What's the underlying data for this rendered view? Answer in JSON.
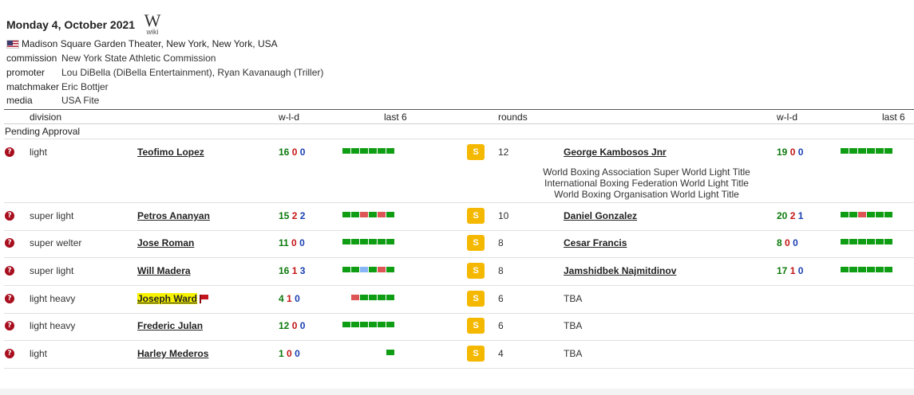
{
  "event": {
    "date": "Monday 4, October 2021",
    "wiki_label": "wiki",
    "wiki_glyph": "W",
    "venue": "Madison Square Garden Theater, New York, New York, USA",
    "meta": [
      {
        "key": "commission",
        "value": "New York State Athletic Commission"
      },
      {
        "key": "promoter",
        "value": "Lou DiBella (DiBella Entertainment), Ryan Kavanaugh (Triller)"
      },
      {
        "key": "matchmaker",
        "value": "Eric Bottjer"
      },
      {
        "key": "media",
        "value": "USA Fite"
      }
    ]
  },
  "table": {
    "headers": {
      "division": "division",
      "wld_left": "w-l-d",
      "last6_left": "last 6",
      "rounds": "rounds",
      "wld_right": "w-l-d",
      "last6_right": "last 6"
    },
    "section_label": "Pending Approval",
    "status_icon": "question-circle-icon",
    "badge_label": "S",
    "colors": {
      "win": "#0f9d14",
      "loss": "#dd5555",
      "draw": "#88b5f5",
      "badge": "#f5b800",
      "highlight": "#f7f300"
    },
    "bouts": [
      {
        "division": "light",
        "boxer1": "Teofimo Lopez",
        "wld1": {
          "w": "16",
          "l": "0",
          "d": "0"
        },
        "last6_1": [
          "W",
          "W",
          "W",
          "W",
          "W",
          "W"
        ],
        "rounds": "12",
        "boxer2": "George Kambosos Jnr",
        "wld2": {
          "w": "19",
          "l": "0",
          "d": "0"
        },
        "last6_2": [
          "W",
          "W",
          "W",
          "W",
          "W",
          "W"
        ],
        "titles": [
          "World Boxing Association Super World Light Title",
          "International Boxing Federation World Light Title",
          "World Boxing Organisation World Light Title"
        ]
      },
      {
        "division": "super light",
        "boxer1": "Petros Ananyan",
        "wld1": {
          "w": "15",
          "l": "2",
          "d": "2"
        },
        "last6_1": [
          "W",
          "W",
          "L",
          "W",
          "L",
          "W"
        ],
        "rounds": "10",
        "boxer2": "Daniel Gonzalez",
        "wld2": {
          "w": "20",
          "l": "2",
          "d": "1"
        },
        "last6_2": [
          "W",
          "W",
          "L",
          "W",
          "W",
          "W"
        ]
      },
      {
        "division": "super welter",
        "boxer1": "Jose Roman",
        "wld1": {
          "w": "11",
          "l": "0",
          "d": "0"
        },
        "last6_1": [
          "W",
          "W",
          "W",
          "W",
          "W",
          "W"
        ],
        "rounds": "8",
        "boxer2": "Cesar Francis",
        "wld2": {
          "w": "8",
          "l": "0",
          "d": "0"
        },
        "last6_2": [
          "W",
          "W",
          "W",
          "W",
          "W",
          "W"
        ]
      },
      {
        "division": "super light",
        "boxer1": "Will Madera",
        "wld1": {
          "w": "16",
          "l": "1",
          "d": "3"
        },
        "last6_1": [
          "W",
          "W",
          "D",
          "W",
          "L",
          "W"
        ],
        "rounds": "8",
        "boxer2": "Jamshidbek Najmitdinov",
        "wld2": {
          "w": "17",
          "l": "1",
          "d": "0"
        },
        "last6_2": [
          "W",
          "W",
          "W",
          "W",
          "W",
          "W"
        ]
      },
      {
        "division": "light heavy",
        "boxer1": "Joseph Ward",
        "boxer1_flagged": true,
        "wld1": {
          "w": "4",
          "l": "1",
          "d": "0"
        },
        "last6_1": [
          "L",
          "W",
          "W",
          "W",
          "W"
        ],
        "rounds": "6",
        "boxer2_tba": "TBA"
      },
      {
        "division": "light heavy",
        "boxer1": "Frederic Julan",
        "wld1": {
          "w": "12",
          "l": "0",
          "d": "0"
        },
        "last6_1": [
          "W",
          "W",
          "W",
          "W",
          "W",
          "W"
        ],
        "rounds": "6",
        "boxer2_tba": "TBA"
      },
      {
        "division": "light",
        "boxer1": "Harley Mederos",
        "wld1": {
          "w": "1",
          "l": "0",
          "d": "0"
        },
        "last6_1": [
          "W"
        ],
        "rounds": "4",
        "boxer2_tba": "TBA"
      }
    ]
  }
}
